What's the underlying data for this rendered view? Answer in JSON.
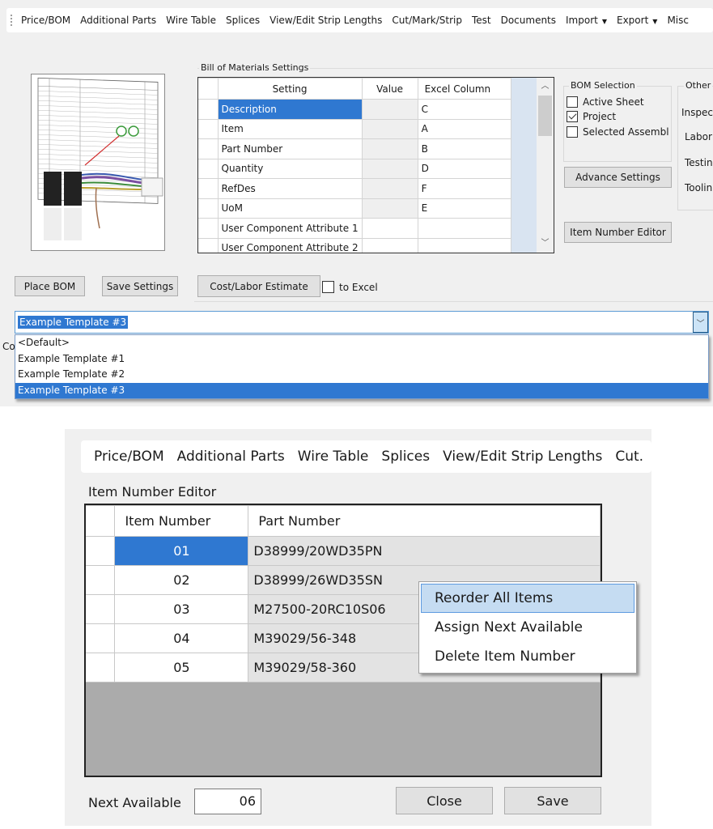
{
  "top": {
    "toolbar": {
      "items": [
        {
          "label": "Price/BOM"
        },
        {
          "label": "Additional Parts"
        },
        {
          "label": "Wire Table"
        },
        {
          "label": "Splices"
        },
        {
          "label": "View/Edit Strip Lengths"
        },
        {
          "label": "Cut/Mark/Strip"
        },
        {
          "label": "Test"
        },
        {
          "label": "Documents"
        },
        {
          "label": "Import",
          "dropdown": true
        },
        {
          "label": "Export",
          "dropdown": true
        },
        {
          "label": "Misc"
        }
      ]
    },
    "bom_settings": {
      "title": "Bill of Materials Settings",
      "columns": [
        "Setting",
        "Value",
        "Excel Column"
      ],
      "rows": [
        {
          "setting": "Description",
          "value": "",
          "excel_column": "C",
          "selected": true
        },
        {
          "setting": "Item",
          "value": "",
          "excel_column": "A"
        },
        {
          "setting": "Part Number",
          "value": "",
          "excel_column": "B"
        },
        {
          "setting": "Quantity",
          "value": "",
          "excel_column": "D"
        },
        {
          "setting": "RefDes",
          "value": "",
          "excel_column": "F"
        },
        {
          "setting": "UoM",
          "value": "",
          "excel_column": "E"
        },
        {
          "setting": "User Component Attribute 1",
          "value": "",
          "excel_column": ""
        },
        {
          "setting": "User Component Attribute 2",
          "value": "",
          "excel_column": ""
        }
      ],
      "scroll_up_icon": "chevron-up-icon",
      "scroll_down_icon": "chevron-down-icon"
    },
    "bom_selection": {
      "title": "BOM Selection",
      "options": [
        {
          "label": "Active Sheet",
          "checked": false
        },
        {
          "label": "Project",
          "checked": true
        },
        {
          "label": "Selected Assembl",
          "checked": false
        }
      ]
    },
    "other": {
      "title": "Other",
      "labels": [
        "Inspec",
        "Labor",
        "Testin",
        "Toolin"
      ]
    },
    "buttons": {
      "advance_settings": "Advance Settings",
      "item_number_editor": "Item Number Editor",
      "place_bom": "Place BOM",
      "save_settings": "Save Settings",
      "cost_labor_estimate": "Cost/Labor Estimate"
    },
    "to_excel": {
      "label": "to Excel",
      "checked": false
    },
    "template_combo": {
      "value": "Example Template #3",
      "options": [
        "<Default>",
        "Example Template #1",
        "Example Template #2",
        "Example Template #3"
      ],
      "selected_index": 3
    },
    "partial_label": "Co"
  },
  "bottom": {
    "toolbar": {
      "items": [
        {
          "label": "Price/BOM"
        },
        {
          "label": "Additional Parts"
        },
        {
          "label": "Wire Table"
        },
        {
          "label": "Splices"
        },
        {
          "label": "View/Edit Strip Lengths"
        },
        {
          "label": "Cut."
        }
      ]
    },
    "title": "Item Number Editor",
    "columns": [
      "Item Number",
      "Part Number"
    ],
    "rows": [
      {
        "item_number": "01",
        "part_number": "D38999/20WD35PN",
        "selected": true
      },
      {
        "item_number": "02",
        "part_number": "D38999/26WD35SN"
      },
      {
        "item_number": "03",
        "part_number": "M27500-20RC10S06"
      },
      {
        "item_number": "04",
        "part_number": "M39029/56-348"
      },
      {
        "item_number": "05",
        "part_number": "M39029/58-360"
      }
    ],
    "context_menu": {
      "items": [
        "Reorder All Items",
        "Assign Next Available",
        "Delete Item Number"
      ],
      "highlighted_index": 0
    },
    "next_available": {
      "label": "Next Available",
      "value": "06"
    },
    "buttons": {
      "close": "Close",
      "save": "Save"
    }
  },
  "colors": {
    "selection": "#2f78d1",
    "menu_hover": "#c5dcf2",
    "panel_bg": "#f0f0f0",
    "button_bg": "#e1e1e1"
  }
}
